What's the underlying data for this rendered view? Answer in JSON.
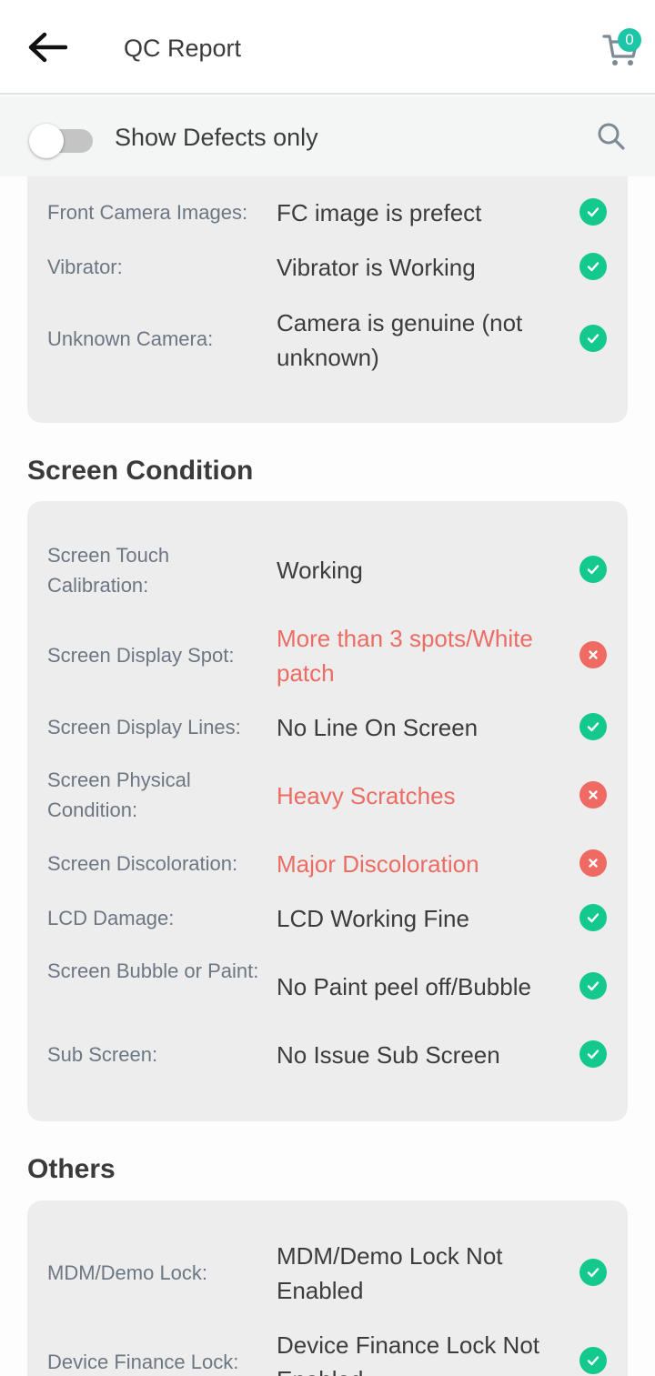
{
  "header": {
    "title": "QC Report",
    "cart_count": "0"
  },
  "filter": {
    "label": "Show Defects only"
  },
  "colors": {
    "accent": "#1cc6a6",
    "ok": "#14c98e",
    "defect": "#ee6a63"
  },
  "camera_section": {
    "rows": [
      {
        "label": "Front Camera Images:",
        "value": "FC image is prefect",
        "status": "ok"
      },
      {
        "label": "Vibrator:",
        "value": "Vibrator is Working",
        "status": "ok"
      },
      {
        "label": "Unknown Camera:",
        "value": "Camera is genuine (not unknown)",
        "status": "ok"
      }
    ]
  },
  "screen_section": {
    "title": "Screen Condition",
    "rows": [
      {
        "label": "Screen Touch Calibration:",
        "value": "Working",
        "status": "ok"
      },
      {
        "label": "Screen Display Spot:",
        "value": "More than 3 spots/White patch",
        "status": "defect"
      },
      {
        "label": "Screen Display Lines:",
        "value": "No Line On Screen",
        "status": "ok"
      },
      {
        "label": "Screen Physical Condition:",
        "value": "Heavy Scratches",
        "status": "defect"
      },
      {
        "label": "Screen Discoloration:",
        "value": "Major Discoloration",
        "status": "defect"
      },
      {
        "label": "LCD Damage:",
        "value": "LCD Working Fine",
        "status": "ok"
      },
      {
        "label": "Screen Bubble or Paint:",
        "value": "No Paint peel off/Bubble",
        "status": "ok"
      },
      {
        "label": "Sub Screen:",
        "value": "No Issue Sub Screen",
        "status": "ok"
      }
    ]
  },
  "others_section": {
    "title": "Others",
    "rows": [
      {
        "label": "MDM/Demo Lock:",
        "value": "MDM/Demo Lock Not Enabled",
        "status": "ok"
      },
      {
        "label": "Device Finance Lock:",
        "value": "Device Finance Lock Not Enabled",
        "status": "ok"
      }
    ]
  }
}
